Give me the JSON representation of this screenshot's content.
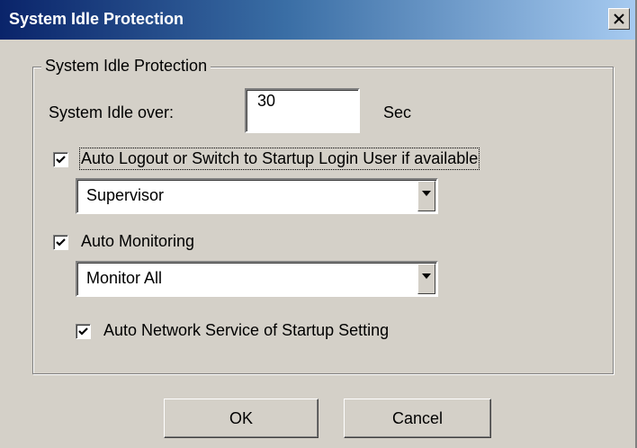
{
  "window": {
    "title": "System Idle Protection"
  },
  "group": {
    "legend": "System Idle Protection"
  },
  "idle": {
    "label": "System Idle over:",
    "value": "30",
    "unit": "Sec"
  },
  "auto_logout": {
    "checked": true,
    "label": "Auto Logout or Switch to Startup Login User if available",
    "selected": "Supervisor"
  },
  "auto_monitoring": {
    "checked": true,
    "label": "Auto Monitoring",
    "selected": "Monitor All"
  },
  "auto_network": {
    "checked": true,
    "label": "Auto Network Service of Startup Setting"
  },
  "buttons": {
    "ok": "OK",
    "cancel": "Cancel"
  },
  "icons": {
    "close": "close-icon",
    "check": "checkmark-icon",
    "dropdown": "dropdown-arrow-icon"
  }
}
